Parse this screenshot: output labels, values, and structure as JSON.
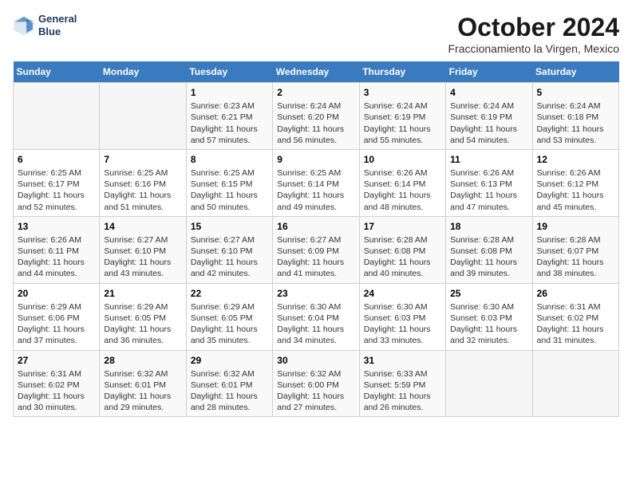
{
  "logo": {
    "line1": "General",
    "line2": "Blue"
  },
  "title": "October 2024",
  "location": "Fraccionamiento la Virgen, Mexico",
  "days_header": [
    "Sunday",
    "Monday",
    "Tuesday",
    "Wednesday",
    "Thursday",
    "Friday",
    "Saturday"
  ],
  "weeks": [
    [
      {
        "day": "",
        "content": ""
      },
      {
        "day": "",
        "content": ""
      },
      {
        "day": "1",
        "content": "Sunrise: 6:23 AM\nSunset: 6:21 PM\nDaylight: 11 hours and 57 minutes."
      },
      {
        "day": "2",
        "content": "Sunrise: 6:24 AM\nSunset: 6:20 PM\nDaylight: 11 hours and 56 minutes."
      },
      {
        "day": "3",
        "content": "Sunrise: 6:24 AM\nSunset: 6:19 PM\nDaylight: 11 hours and 55 minutes."
      },
      {
        "day": "4",
        "content": "Sunrise: 6:24 AM\nSunset: 6:19 PM\nDaylight: 11 hours and 54 minutes."
      },
      {
        "day": "5",
        "content": "Sunrise: 6:24 AM\nSunset: 6:18 PM\nDaylight: 11 hours and 53 minutes."
      }
    ],
    [
      {
        "day": "6",
        "content": "Sunrise: 6:25 AM\nSunset: 6:17 PM\nDaylight: 11 hours and 52 minutes."
      },
      {
        "day": "7",
        "content": "Sunrise: 6:25 AM\nSunset: 6:16 PM\nDaylight: 11 hours and 51 minutes."
      },
      {
        "day": "8",
        "content": "Sunrise: 6:25 AM\nSunset: 6:15 PM\nDaylight: 11 hours and 50 minutes."
      },
      {
        "day": "9",
        "content": "Sunrise: 6:25 AM\nSunset: 6:14 PM\nDaylight: 11 hours and 49 minutes."
      },
      {
        "day": "10",
        "content": "Sunrise: 6:26 AM\nSunset: 6:14 PM\nDaylight: 11 hours and 48 minutes."
      },
      {
        "day": "11",
        "content": "Sunrise: 6:26 AM\nSunset: 6:13 PM\nDaylight: 11 hours and 47 minutes."
      },
      {
        "day": "12",
        "content": "Sunrise: 6:26 AM\nSunset: 6:12 PM\nDaylight: 11 hours and 45 minutes."
      }
    ],
    [
      {
        "day": "13",
        "content": "Sunrise: 6:26 AM\nSunset: 6:11 PM\nDaylight: 11 hours and 44 minutes."
      },
      {
        "day": "14",
        "content": "Sunrise: 6:27 AM\nSunset: 6:10 PM\nDaylight: 11 hours and 43 minutes."
      },
      {
        "day": "15",
        "content": "Sunrise: 6:27 AM\nSunset: 6:10 PM\nDaylight: 11 hours and 42 minutes."
      },
      {
        "day": "16",
        "content": "Sunrise: 6:27 AM\nSunset: 6:09 PM\nDaylight: 11 hours and 41 minutes."
      },
      {
        "day": "17",
        "content": "Sunrise: 6:28 AM\nSunset: 6:08 PM\nDaylight: 11 hours and 40 minutes."
      },
      {
        "day": "18",
        "content": "Sunrise: 6:28 AM\nSunset: 6:08 PM\nDaylight: 11 hours and 39 minutes."
      },
      {
        "day": "19",
        "content": "Sunrise: 6:28 AM\nSunset: 6:07 PM\nDaylight: 11 hours and 38 minutes."
      }
    ],
    [
      {
        "day": "20",
        "content": "Sunrise: 6:29 AM\nSunset: 6:06 PM\nDaylight: 11 hours and 37 minutes."
      },
      {
        "day": "21",
        "content": "Sunrise: 6:29 AM\nSunset: 6:05 PM\nDaylight: 11 hours and 36 minutes."
      },
      {
        "day": "22",
        "content": "Sunrise: 6:29 AM\nSunset: 6:05 PM\nDaylight: 11 hours and 35 minutes."
      },
      {
        "day": "23",
        "content": "Sunrise: 6:30 AM\nSunset: 6:04 PM\nDaylight: 11 hours and 34 minutes."
      },
      {
        "day": "24",
        "content": "Sunrise: 6:30 AM\nSunset: 6:03 PM\nDaylight: 11 hours and 33 minutes."
      },
      {
        "day": "25",
        "content": "Sunrise: 6:30 AM\nSunset: 6:03 PM\nDaylight: 11 hours and 32 minutes."
      },
      {
        "day": "26",
        "content": "Sunrise: 6:31 AM\nSunset: 6:02 PM\nDaylight: 11 hours and 31 minutes."
      }
    ],
    [
      {
        "day": "27",
        "content": "Sunrise: 6:31 AM\nSunset: 6:02 PM\nDaylight: 11 hours and 30 minutes."
      },
      {
        "day": "28",
        "content": "Sunrise: 6:32 AM\nSunset: 6:01 PM\nDaylight: 11 hours and 29 minutes."
      },
      {
        "day": "29",
        "content": "Sunrise: 6:32 AM\nSunset: 6:01 PM\nDaylight: 11 hours and 28 minutes."
      },
      {
        "day": "30",
        "content": "Sunrise: 6:32 AM\nSunset: 6:00 PM\nDaylight: 11 hours and 27 minutes."
      },
      {
        "day": "31",
        "content": "Sunrise: 6:33 AM\nSunset: 5:59 PM\nDaylight: 11 hours and 26 minutes."
      },
      {
        "day": "",
        "content": ""
      },
      {
        "day": "",
        "content": ""
      }
    ]
  ]
}
